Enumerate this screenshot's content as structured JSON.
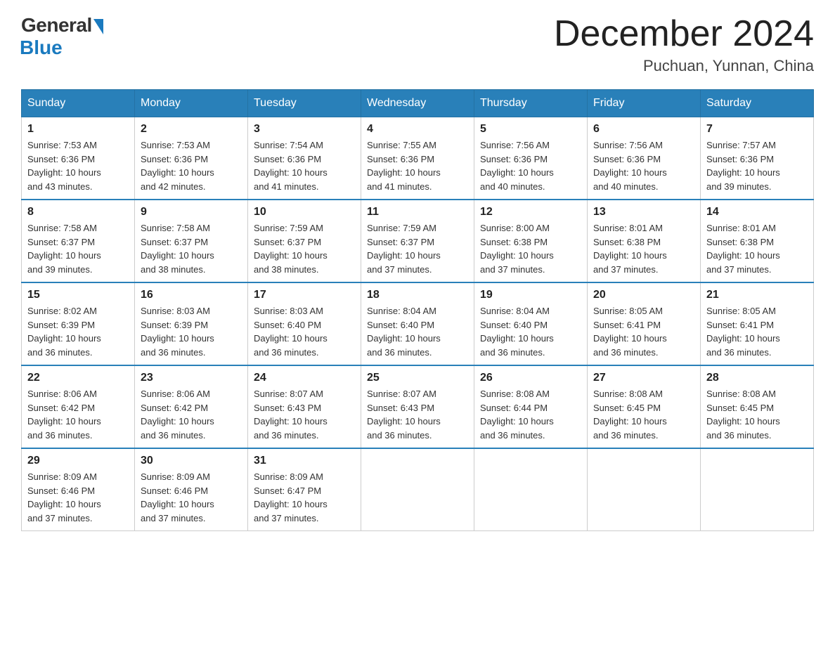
{
  "logo": {
    "general": "General",
    "blue": "Blue"
  },
  "title": "December 2024",
  "location": "Puchuan, Yunnan, China",
  "days_of_week": [
    "Sunday",
    "Monday",
    "Tuesday",
    "Wednesday",
    "Thursday",
    "Friday",
    "Saturday"
  ],
  "weeks": [
    [
      {
        "day": 1,
        "sunrise": "7:53 AM",
        "sunset": "6:36 PM",
        "daylight": "10 hours and 43 minutes."
      },
      {
        "day": 2,
        "sunrise": "7:53 AM",
        "sunset": "6:36 PM",
        "daylight": "10 hours and 42 minutes."
      },
      {
        "day": 3,
        "sunrise": "7:54 AM",
        "sunset": "6:36 PM",
        "daylight": "10 hours and 41 minutes."
      },
      {
        "day": 4,
        "sunrise": "7:55 AM",
        "sunset": "6:36 PM",
        "daylight": "10 hours and 41 minutes."
      },
      {
        "day": 5,
        "sunrise": "7:56 AM",
        "sunset": "6:36 PM",
        "daylight": "10 hours and 40 minutes."
      },
      {
        "day": 6,
        "sunrise": "7:56 AM",
        "sunset": "6:36 PM",
        "daylight": "10 hours and 40 minutes."
      },
      {
        "day": 7,
        "sunrise": "7:57 AM",
        "sunset": "6:36 PM",
        "daylight": "10 hours and 39 minutes."
      }
    ],
    [
      {
        "day": 8,
        "sunrise": "7:58 AM",
        "sunset": "6:37 PM",
        "daylight": "10 hours and 39 minutes."
      },
      {
        "day": 9,
        "sunrise": "7:58 AM",
        "sunset": "6:37 PM",
        "daylight": "10 hours and 38 minutes."
      },
      {
        "day": 10,
        "sunrise": "7:59 AM",
        "sunset": "6:37 PM",
        "daylight": "10 hours and 38 minutes."
      },
      {
        "day": 11,
        "sunrise": "7:59 AM",
        "sunset": "6:37 PM",
        "daylight": "10 hours and 37 minutes."
      },
      {
        "day": 12,
        "sunrise": "8:00 AM",
        "sunset": "6:38 PM",
        "daylight": "10 hours and 37 minutes."
      },
      {
        "day": 13,
        "sunrise": "8:01 AM",
        "sunset": "6:38 PM",
        "daylight": "10 hours and 37 minutes."
      },
      {
        "day": 14,
        "sunrise": "8:01 AM",
        "sunset": "6:38 PM",
        "daylight": "10 hours and 37 minutes."
      }
    ],
    [
      {
        "day": 15,
        "sunrise": "8:02 AM",
        "sunset": "6:39 PM",
        "daylight": "10 hours and 36 minutes."
      },
      {
        "day": 16,
        "sunrise": "8:03 AM",
        "sunset": "6:39 PM",
        "daylight": "10 hours and 36 minutes."
      },
      {
        "day": 17,
        "sunrise": "8:03 AM",
        "sunset": "6:40 PM",
        "daylight": "10 hours and 36 minutes."
      },
      {
        "day": 18,
        "sunrise": "8:04 AM",
        "sunset": "6:40 PM",
        "daylight": "10 hours and 36 minutes."
      },
      {
        "day": 19,
        "sunrise": "8:04 AM",
        "sunset": "6:40 PM",
        "daylight": "10 hours and 36 minutes."
      },
      {
        "day": 20,
        "sunrise": "8:05 AM",
        "sunset": "6:41 PM",
        "daylight": "10 hours and 36 minutes."
      },
      {
        "day": 21,
        "sunrise": "8:05 AM",
        "sunset": "6:41 PM",
        "daylight": "10 hours and 36 minutes."
      }
    ],
    [
      {
        "day": 22,
        "sunrise": "8:06 AM",
        "sunset": "6:42 PM",
        "daylight": "10 hours and 36 minutes."
      },
      {
        "day": 23,
        "sunrise": "8:06 AM",
        "sunset": "6:42 PM",
        "daylight": "10 hours and 36 minutes."
      },
      {
        "day": 24,
        "sunrise": "8:07 AM",
        "sunset": "6:43 PM",
        "daylight": "10 hours and 36 minutes."
      },
      {
        "day": 25,
        "sunrise": "8:07 AM",
        "sunset": "6:43 PM",
        "daylight": "10 hours and 36 minutes."
      },
      {
        "day": 26,
        "sunrise": "8:08 AM",
        "sunset": "6:44 PM",
        "daylight": "10 hours and 36 minutes."
      },
      {
        "day": 27,
        "sunrise": "8:08 AM",
        "sunset": "6:45 PM",
        "daylight": "10 hours and 36 minutes."
      },
      {
        "day": 28,
        "sunrise": "8:08 AM",
        "sunset": "6:45 PM",
        "daylight": "10 hours and 36 minutes."
      }
    ],
    [
      {
        "day": 29,
        "sunrise": "8:09 AM",
        "sunset": "6:46 PM",
        "daylight": "10 hours and 37 minutes."
      },
      {
        "day": 30,
        "sunrise": "8:09 AM",
        "sunset": "6:46 PM",
        "daylight": "10 hours and 37 minutes."
      },
      {
        "day": 31,
        "sunrise": "8:09 AM",
        "sunset": "6:47 PM",
        "daylight": "10 hours and 37 minutes."
      },
      null,
      null,
      null,
      null
    ]
  ],
  "labels": {
    "sunrise": "Sunrise:",
    "sunset": "Sunset:",
    "daylight": "Daylight:"
  }
}
